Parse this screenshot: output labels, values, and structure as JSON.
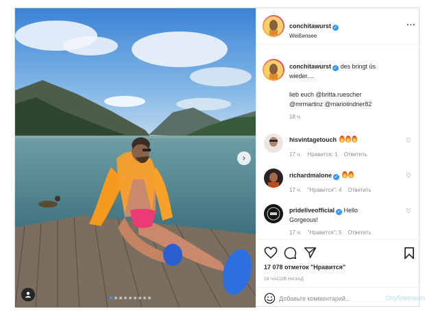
{
  "post": {
    "author": {
      "username": "conchitawurst",
      "verified": true,
      "location": "Weißensee"
    },
    "photo": {
      "slide_count": 9,
      "active_slide": 1
    },
    "caption": {
      "username": "conchitawurst",
      "line1": "des bringt üs",
      "line2": "wieder....",
      "line3": "lieb euch @britta.ruescher",
      "line4": "@mrmartinz @mariolindner82",
      "time": "18 ч."
    },
    "comments": [
      {
        "username": "hisvintagetouch",
        "verified": false,
        "text": "",
        "emoji_count": 3,
        "time": "17 ч.",
        "likes": "Нравится: 1",
        "reply": "Ответить"
      },
      {
        "username": "richardmalone",
        "verified": true,
        "text": "",
        "emoji_count": 2,
        "time": "17 ч.",
        "likes": "\"Нравится\": 4",
        "reply": "Ответить"
      },
      {
        "username": "prideliveofficial",
        "verified": true,
        "text": "Hello",
        "text2": "Gorgeous!",
        "time": "17 ч.",
        "likes": "\"Нравится\": 5",
        "reply": "Ответить"
      }
    ],
    "likes": "17 078 отметок \"Нравится\"",
    "time_ago": "18 ЧАСОВ НАЗАД",
    "add_comment": {
      "placeholder": "Добавьте комментарий...",
      "publish": "Опубликовать"
    }
  },
  "icons": {
    "verified": "✓",
    "more": "···",
    "next": "›",
    "heart_small": "♡"
  },
  "colors": {
    "link": "#3897f0",
    "muted": "#8e8e8e",
    "publish_disabled": "#b2dffc",
    "border": "#dbdbdb"
  }
}
